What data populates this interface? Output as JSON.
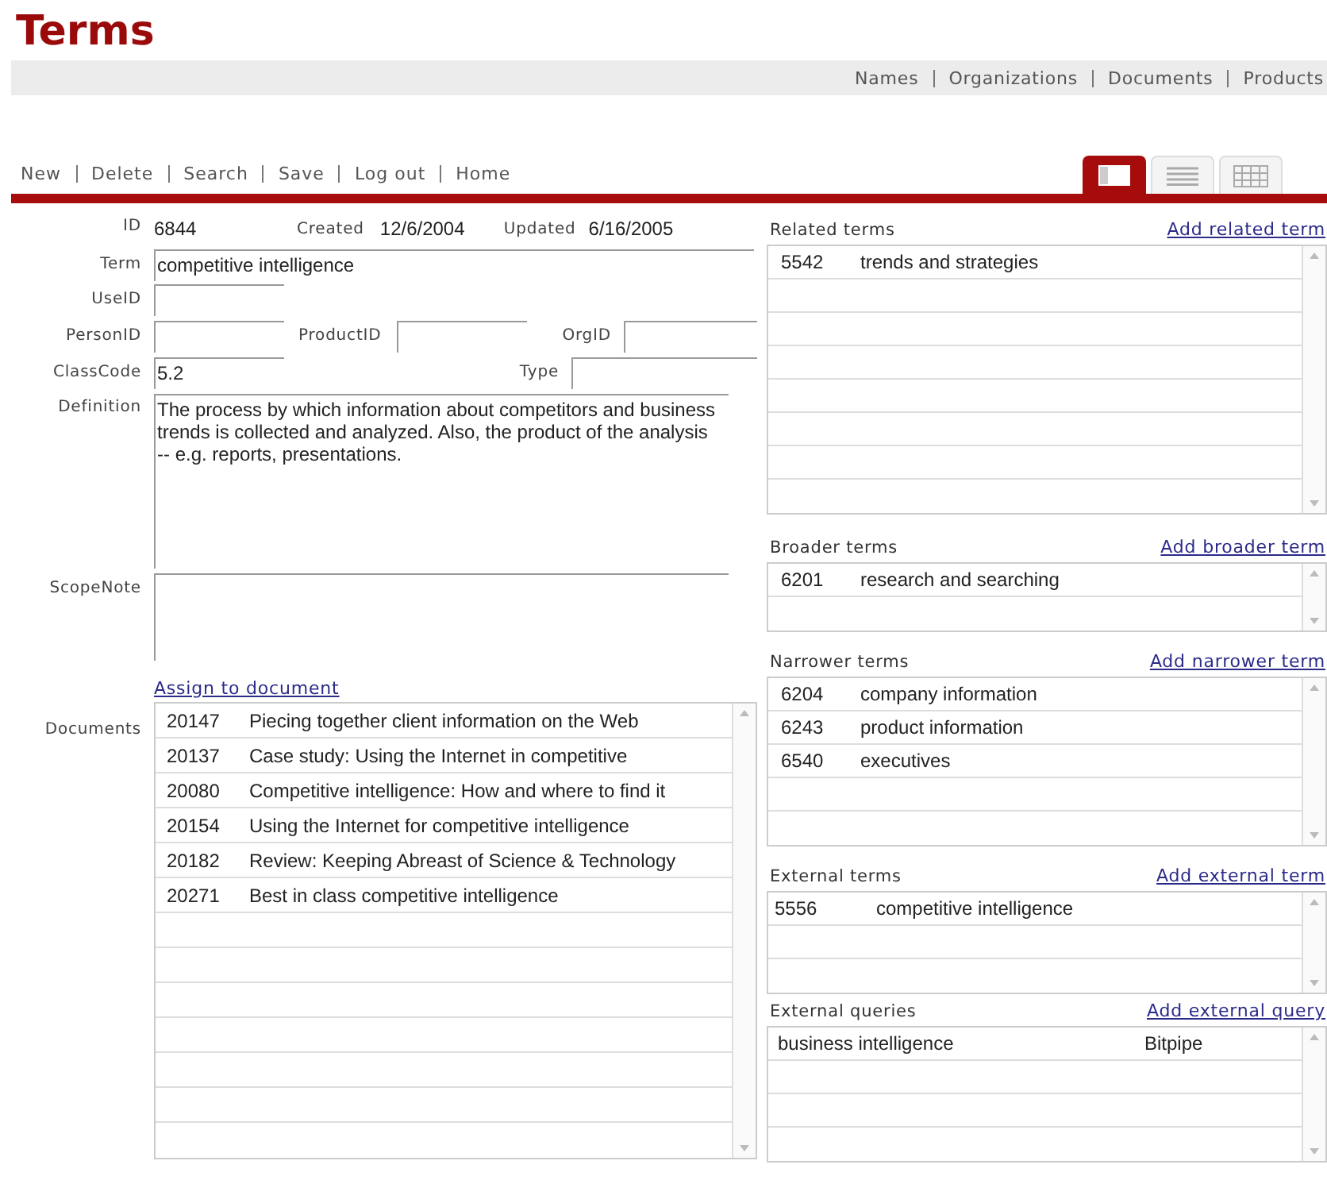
{
  "title": "Terms",
  "nav_links": [
    "Names",
    "Organizations",
    "Documents",
    "Products"
  ],
  "toolbar": [
    "New",
    "Delete",
    "Search",
    "Save",
    "Log out",
    "Home"
  ],
  "view_tabs": [
    {
      "kind": "detail",
      "selected": true
    },
    {
      "kind": "list",
      "selected": false
    },
    {
      "kind": "grid",
      "selected": false
    }
  ],
  "record": {
    "id_label": "ID",
    "id": "6844",
    "created_label": "Created",
    "created": "12/6/2004",
    "updated_label": "Updated",
    "updated": "6/16/2005"
  },
  "form": {
    "term": {
      "label": "Term",
      "value": "competitive intelligence"
    },
    "use_id": {
      "label": "UseID"
    },
    "person_id": {
      "label": "PersonID"
    },
    "product_id": {
      "label": "ProductID"
    },
    "org_id": {
      "label": "OrgID"
    },
    "class_code": {
      "label": "ClassCode",
      "value": "5.2"
    },
    "type": {
      "label": "Type"
    },
    "definition": {
      "label": "Definition",
      "value": "The process by which information about competitors and business trends is collected and analyzed. Also, the product of the analysis -- e.g. reports, presentations."
    },
    "scope_note": {
      "label": "ScopeNote"
    }
  },
  "documents": {
    "link": "Assign to document",
    "label": "Documents",
    "rows": [
      {
        "id": "20147",
        "title": "Piecing together client information on the Web"
      },
      {
        "id": "20137",
        "title": "Case study: Using the Internet in competitive"
      },
      {
        "id": "20080",
        "title": "Competitive intelligence: How and where to find it"
      },
      {
        "id": "20154",
        "title": "Using the Internet for competitive intelligence"
      },
      {
        "id": "20182",
        "title": "Review: Keeping Abreast of Science & Technology"
      },
      {
        "id": "20271",
        "title": "Best in class competitive intelligence"
      }
    ]
  },
  "term_lists": [
    {
      "kind": "term",
      "title": "Related terms",
      "link": "Add related term",
      "rows": [
        [
          "5542",
          "trends and strategies"
        ]
      ]
    },
    {
      "kind": "term",
      "title": "Broader terms",
      "link": "Add broader term",
      "rows": [
        [
          "6201",
          "research and searching"
        ]
      ]
    },
    {
      "kind": "term",
      "title": "Narrower terms",
      "link": "Add narrower term",
      "rows": [
        [
          "6204",
          "company information"
        ],
        [
          "6243",
          "product information"
        ],
        [
          "6540",
          "executives"
        ]
      ]
    },
    {
      "kind": "external",
      "title": "External terms",
      "link": "Add external term",
      "rows": [
        [
          "5556",
          "competitive intelligence"
        ]
      ]
    },
    {
      "kind": "query",
      "title": "External queries",
      "link": "Add external query",
      "rows": [
        [
          "business intelligence",
          "Bitpipe"
        ]
      ]
    }
  ]
}
